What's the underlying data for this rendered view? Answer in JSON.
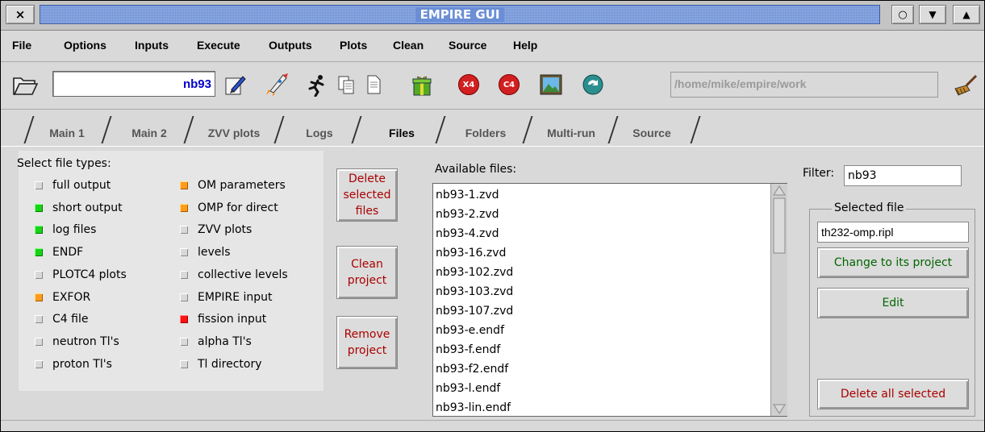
{
  "window": {
    "title": "EMPIRE GUI",
    "close_glyph": "×",
    "iconify_glyph": "○",
    "menu_glyph": "▼",
    "max_glyph": "▲"
  },
  "menu": [
    "File",
    "Options",
    "Inputs",
    "Execute",
    "Outputs",
    "Plots",
    "Clean",
    "Source",
    "Help"
  ],
  "toolbar": {
    "project_value": "nb93",
    "path": "/home/mike/empire/work",
    "icons": [
      "open-folder-icon",
      "edit-icon",
      "rocket-icon",
      "runner-icon",
      "copy-icon",
      "document-icon",
      "gift-icon",
      "x4-icon",
      "c4-icon",
      "image-icon",
      "refresh-icon",
      "broom-icon"
    ],
    "x4_label": "X4",
    "c4_label": "C4"
  },
  "tabs": [
    "Main 1",
    "Main 2",
    "ZVV plots",
    "Logs",
    "Files",
    "Folders",
    "Multi-run",
    "Source"
  ],
  "active_tab": "Files",
  "file_types": {
    "title": "Select file types:",
    "col1": [
      {
        "label": "full output",
        "state": "off"
      },
      {
        "label": "short output",
        "state": "green"
      },
      {
        "label": "log files",
        "state": "green"
      },
      {
        "label": "ENDF",
        "state": "green"
      },
      {
        "label": "PLOTC4 plots",
        "state": "off"
      },
      {
        "label": "EXFOR",
        "state": "orange"
      },
      {
        "label": "C4 file",
        "state": "off"
      },
      {
        "label": "neutron Tl's",
        "state": "off"
      },
      {
        "label": "proton Tl's",
        "state": "off"
      }
    ],
    "col2": [
      {
        "label": "OM parameters",
        "state": "orange"
      },
      {
        "label": "OMP for direct",
        "state": "orange"
      },
      {
        "label": "ZVV plots",
        "state": "off"
      },
      {
        "label": "levels",
        "state": "off"
      },
      {
        "label": "collective levels",
        "state": "off"
      },
      {
        "label": "EMPIRE input",
        "state": "off"
      },
      {
        "label": "fission input",
        "state": "red"
      },
      {
        "label": "alpha Tl's",
        "state": "off"
      },
      {
        "label": "Tl directory",
        "state": "off"
      }
    ]
  },
  "actions": {
    "delete_selected": "Delete\nselected\nfiles",
    "clean_project": "Clean\nproject",
    "remove_project": "Remove\nproject"
  },
  "files": {
    "label": "Available files:",
    "items": [
      "nb93-1.zvd",
      "nb93-2.zvd",
      "nb93-4.zvd",
      "nb93-16.zvd",
      "nb93-102.zvd",
      "nb93-103.zvd",
      "nb93-107.zvd",
      "nb93-e.endf",
      "nb93-f.endf",
      "nb93-f2.endf",
      "nb93-l.endf",
      "nb93-lin.endf"
    ]
  },
  "filter": {
    "label": "Filter:",
    "value": "nb93"
  },
  "selected": {
    "title": "Selected file",
    "value": "th232-omp.ripl",
    "change_label": "Change to its project",
    "edit_label": "Edit",
    "delete_all_label": "Delete all selected"
  },
  "colors": {
    "green": "#16d316",
    "orange": "#ff9c1a",
    "red": "#ff1111",
    "action_text": "#aa0000",
    "change_text": "#006600"
  }
}
